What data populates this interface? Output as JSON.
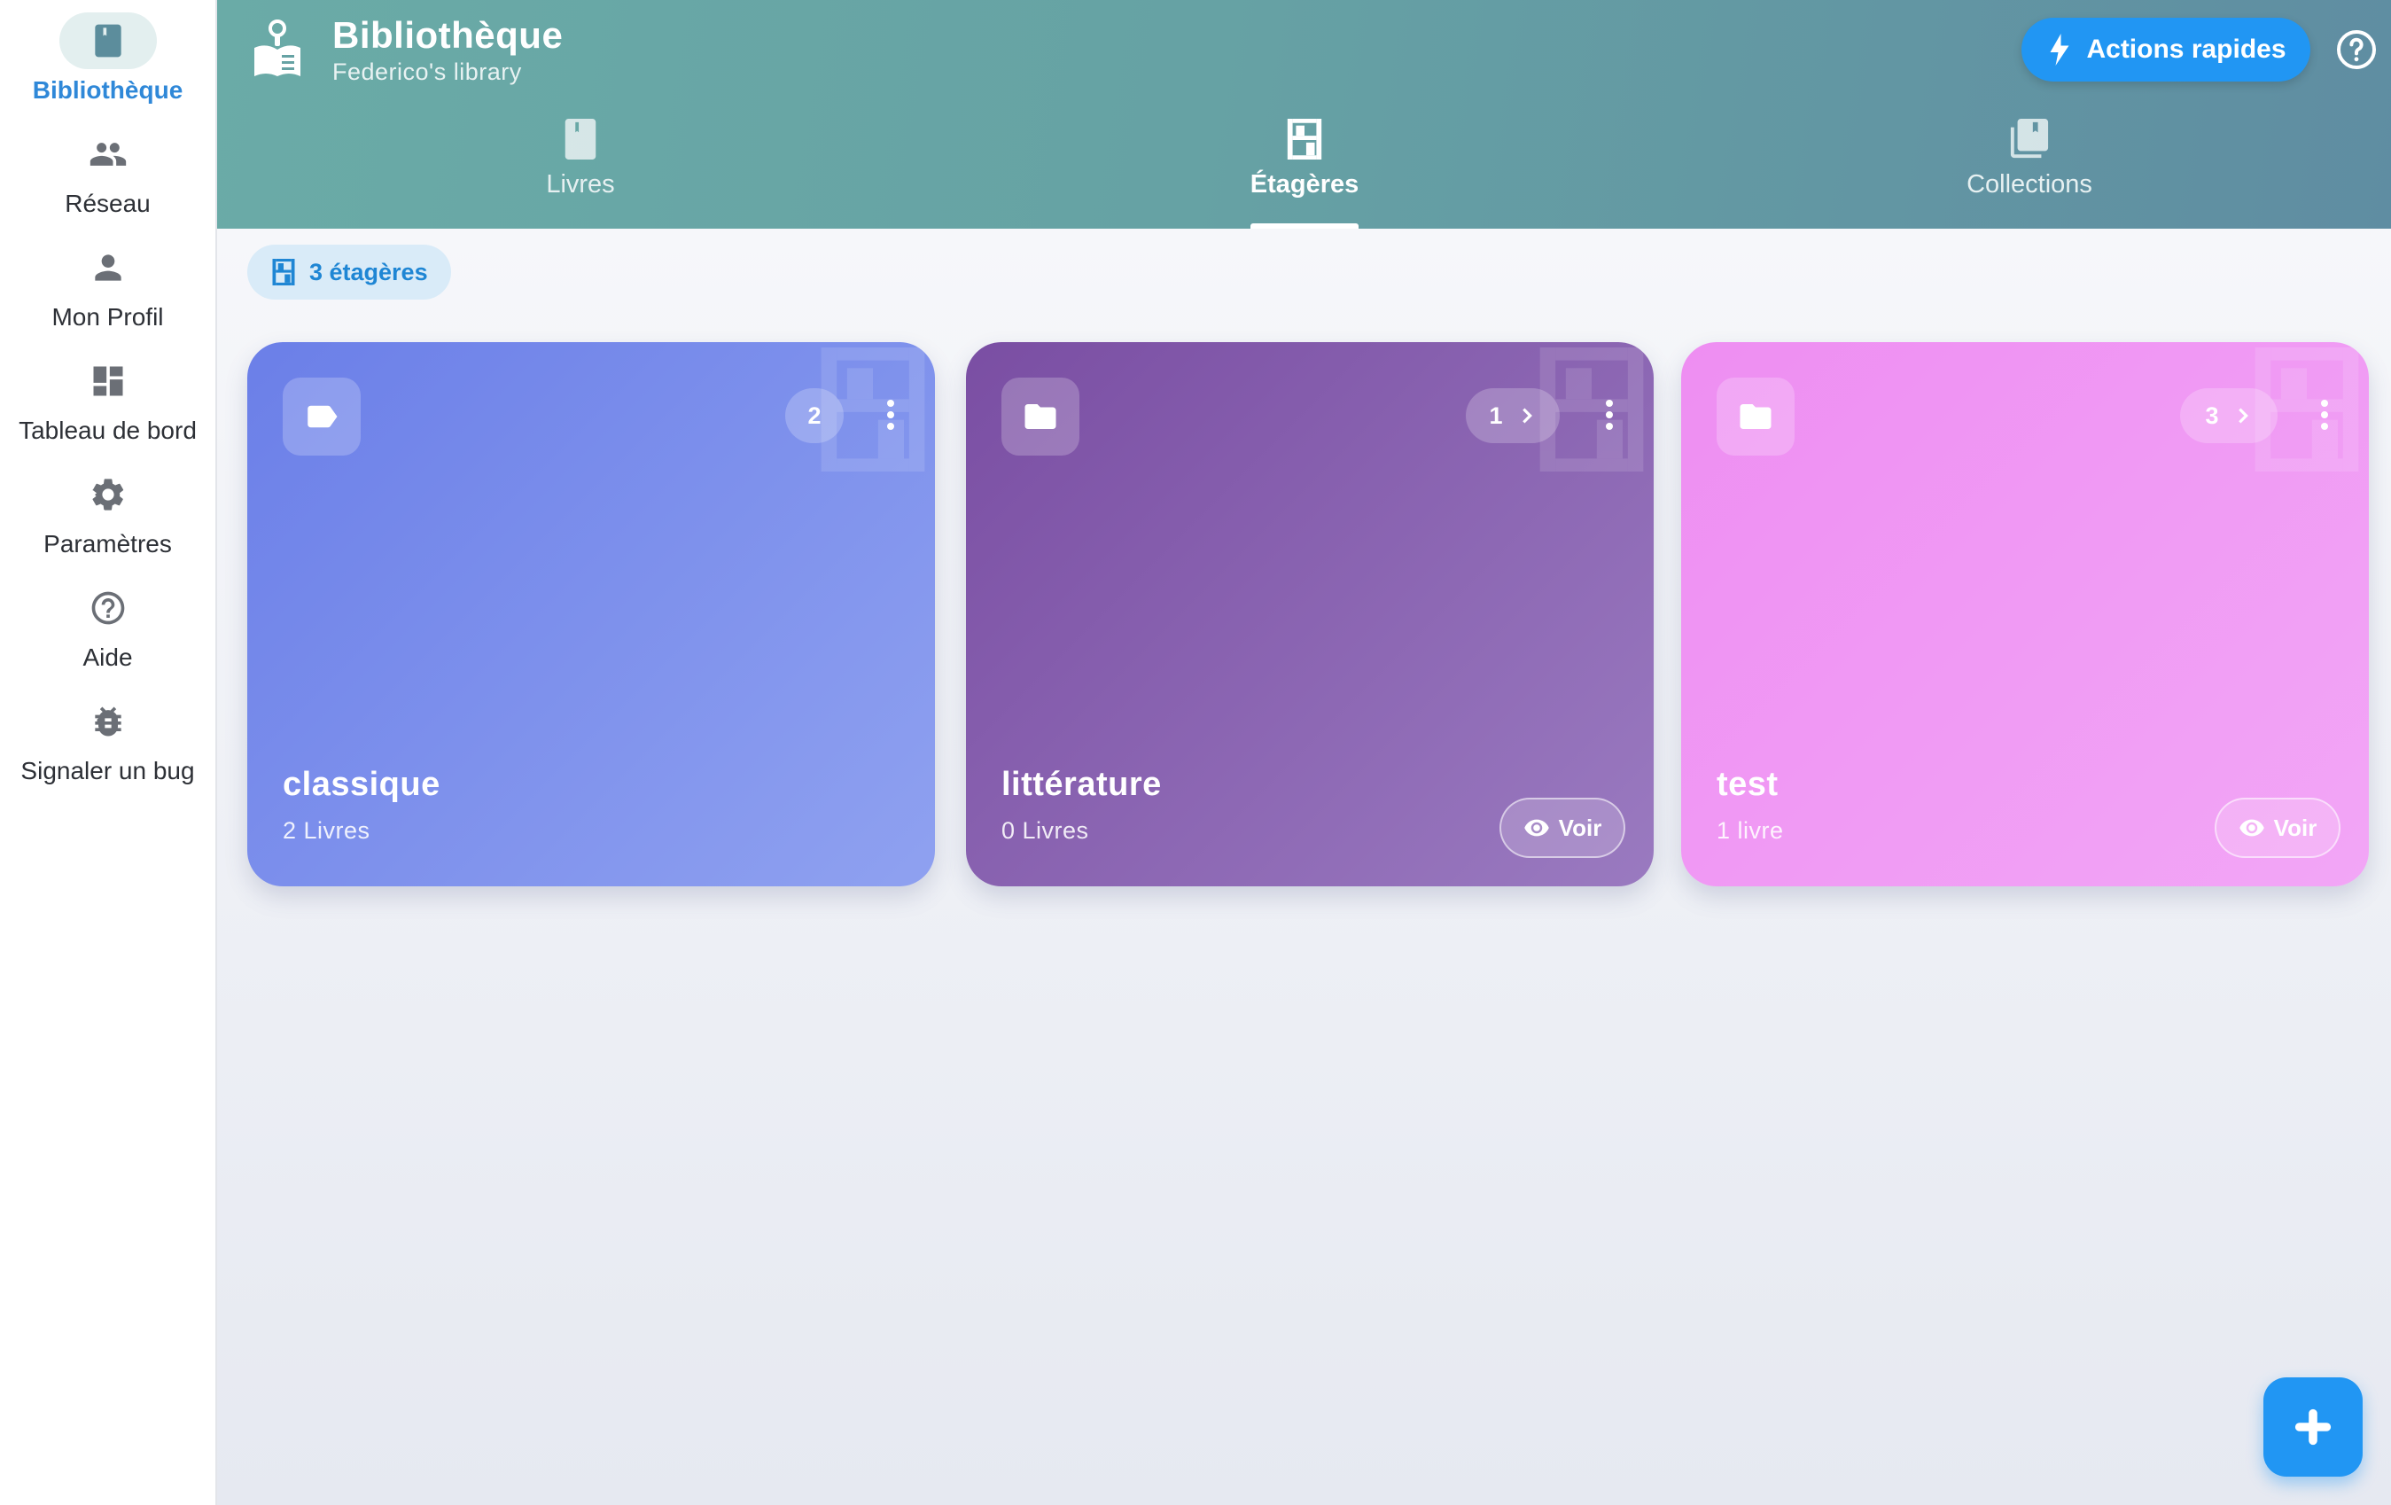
{
  "sidebar": {
    "items": [
      {
        "label": "Bibliothèque",
        "icon": "book-icon",
        "active": true
      },
      {
        "label": "Réseau",
        "icon": "people-icon",
        "active": false
      },
      {
        "label": "Mon Profil",
        "icon": "person-icon",
        "active": false
      },
      {
        "label": "Tableau de bord",
        "icon": "dashboard-icon",
        "active": false
      },
      {
        "label": "Paramètres",
        "icon": "gear-icon",
        "active": false
      },
      {
        "label": "Aide",
        "icon": "help-circle-icon",
        "active": false
      },
      {
        "label": "Signaler un bug",
        "icon": "bug-icon",
        "active": false
      }
    ]
  },
  "header": {
    "title": "Bibliothèque",
    "subtitle": "Federico's library",
    "logo_icon": "library-reader-icon",
    "quick_actions_label": "Actions rapides",
    "quick_actions_icon": "bolt-icon",
    "help_icon": "help-circle-icon",
    "tabs": [
      {
        "label": "Livres",
        "icon": "book-icon",
        "active": false
      },
      {
        "label": "Étagères",
        "icon": "shelf-icon",
        "active": true
      },
      {
        "label": "Collections",
        "icon": "collections-icon",
        "active": false
      }
    ]
  },
  "main": {
    "count_chip": "3 étagères",
    "count_chip_icon": "shelf-icon",
    "shelves": [
      {
        "title": "classique",
        "subtitle": "2 Livres",
        "count": "2",
        "icon": "label-icon",
        "has_arrow": false,
        "has_view": false,
        "view_label": "",
        "colors": [
          "#6b7fe8",
          "#8fa1f0"
        ]
      },
      {
        "title": "littérature",
        "subtitle": "0 Livres",
        "count": "1",
        "icon": "folder-icon",
        "has_arrow": true,
        "has_view": true,
        "view_label": "Voir",
        "colors": [
          "#7a4ea3",
          "#9a7ac0"
        ]
      },
      {
        "title": "test",
        "subtitle": "1 livre",
        "count": "3",
        "icon": "folder-icon",
        "has_arrow": true,
        "has_view": true,
        "view_label": "Voir",
        "colors": [
          "#ee8ef2",
          "#f2a6f6"
        ]
      }
    ]
  },
  "fab": {
    "icon": "plus-icon"
  },
  "colors": {
    "accent": "#2196f3",
    "active_nav": "#2f88d8",
    "header_start": "#6aaba7",
    "header_end": "#5f8da2"
  }
}
